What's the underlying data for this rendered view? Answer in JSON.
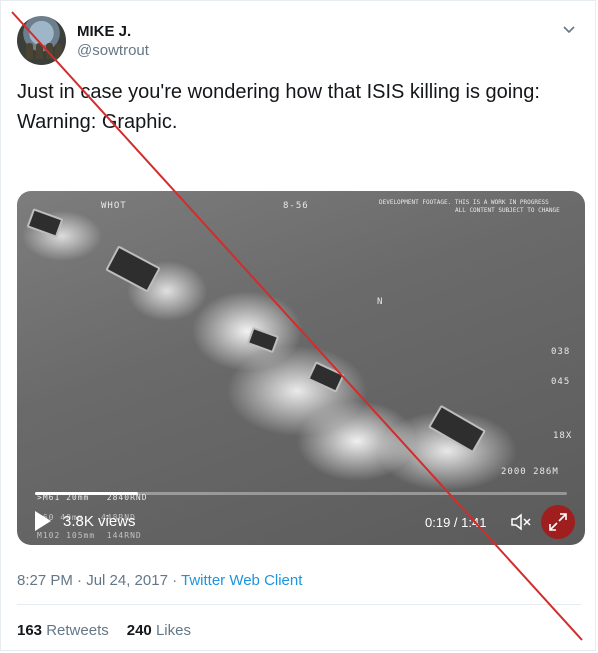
{
  "user": {
    "name": "MIKE J.",
    "handle": "@sowtrout"
  },
  "tweet": {
    "line1": "Just in case you're wondering how that ISIS killing is going:",
    "line2": "Warning: Graphic."
  },
  "video": {
    "hud": {
      "top_left": "WHOT",
      "top_center": "8-56",
      "top_right_1": "DEVELOPMENT FOOTAGE. THIS IS A WORK IN PROGRESS",
      "top_right_2": "ALL CONTENT SUBJECT TO CHANGE",
      "marker": "N",
      "right_1": "038",
      "right_2": "045",
      "right_3": "18X",
      "bottom_right": "2000 286M",
      "bl_1": ">M61 20mm   2840RND",
      "bl_2": "L60 40mm   448RND",
      "bl_3": "M102 105mm  144RND"
    },
    "progress_fraction": 0.194,
    "views": "3.8K views",
    "time": "0:19 / 1:41"
  },
  "meta": {
    "time": "8:27 PM · Jul 24, 2017 · ",
    "client": "Twitter Web Client"
  },
  "stats": {
    "retweets_count": "163",
    "retweets_label": "Retweets",
    "likes_count": "240",
    "likes_label": "Likes"
  },
  "colors": {
    "accent": "#1b95e0",
    "overlay_line": "#d22c2c"
  }
}
